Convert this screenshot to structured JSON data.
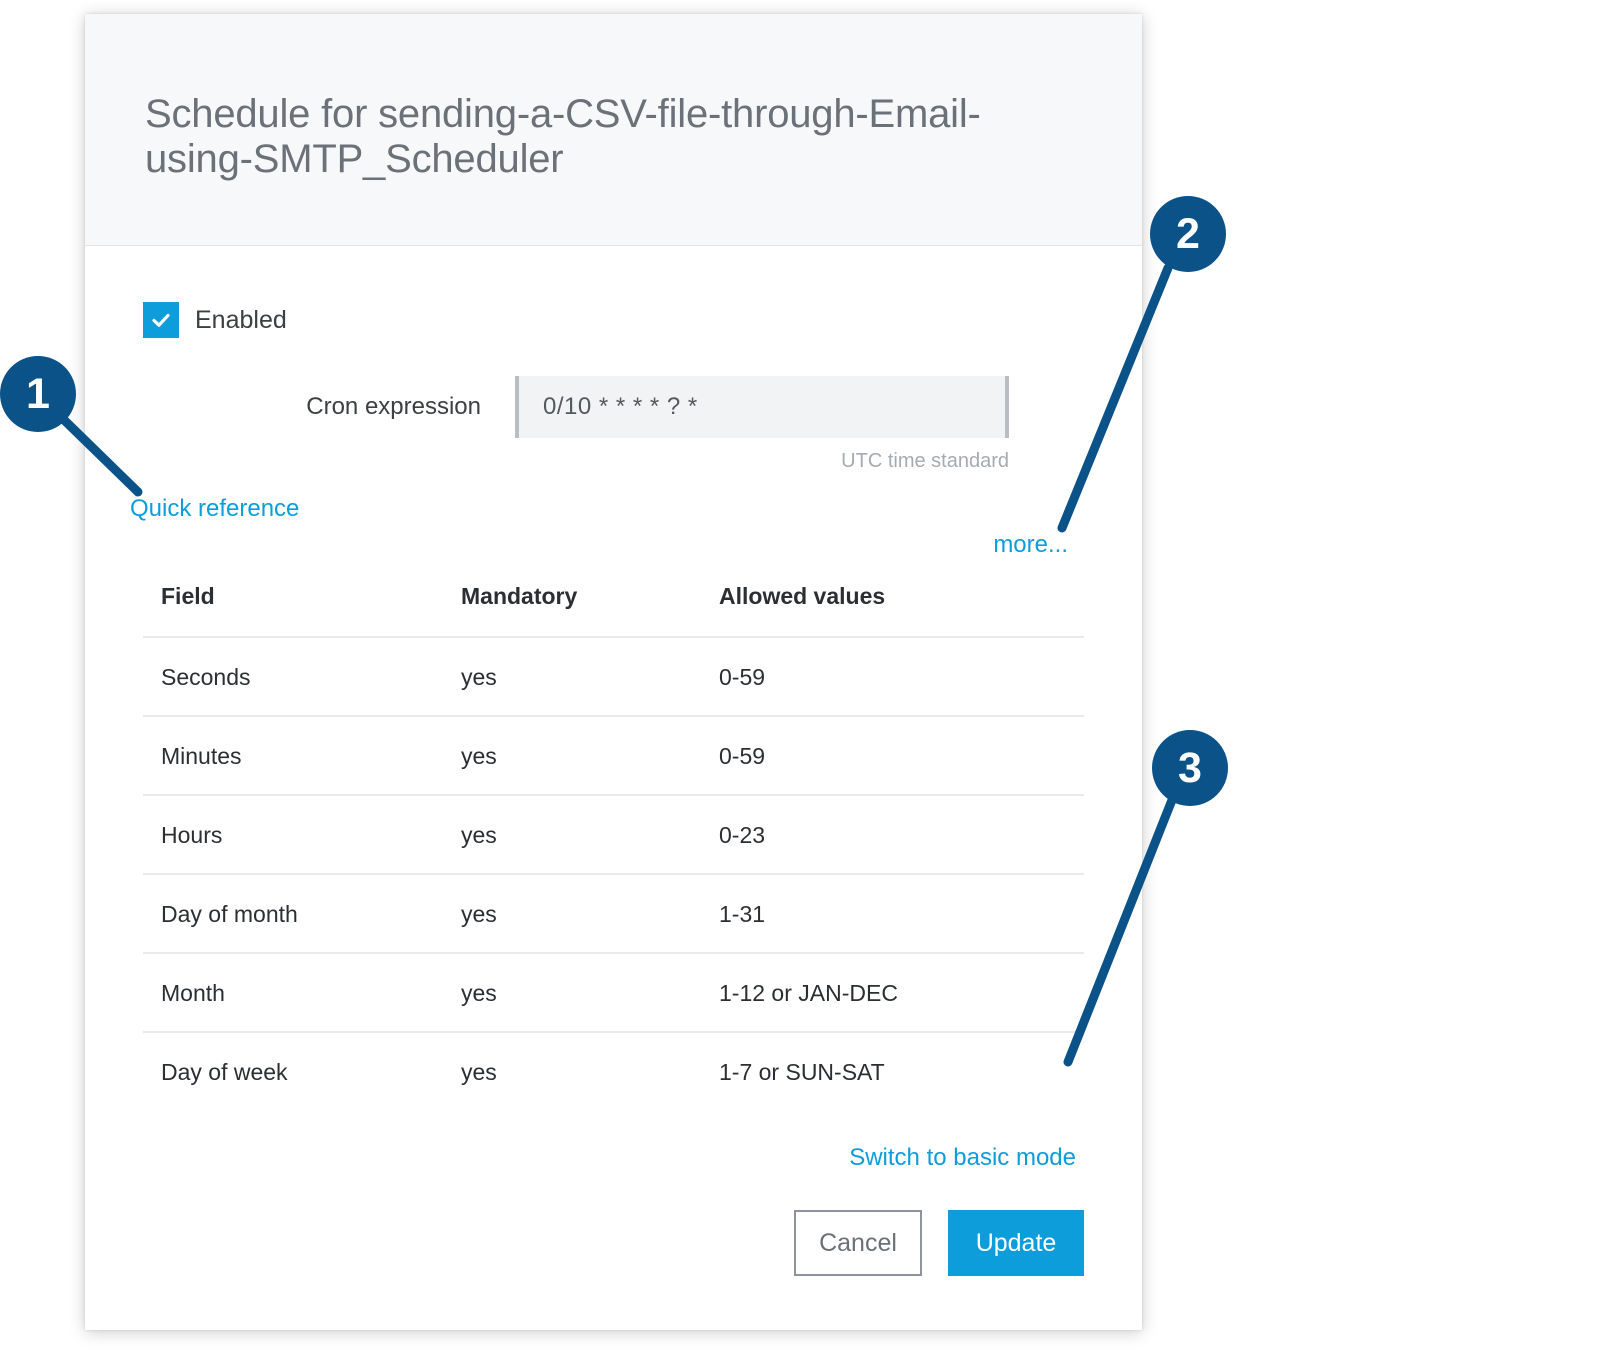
{
  "dialog": {
    "title": "Schedule for sending-a-CSV-file-through-Email-using-SMTP_Scheduler",
    "enabled": {
      "label": "Enabled",
      "checked": true,
      "accent_color": "#0d9ddb"
    },
    "cron": {
      "label": "Cron expression",
      "value": "0/10 * * * * ? *",
      "placeholder": "0/10 * * * * ? *",
      "hint": "UTC time standard"
    },
    "links": {
      "quick_reference": "Quick reference",
      "more": "more...",
      "switch_mode": "Switch to basic mode",
      "color": "#0d9ddb"
    },
    "quick_reference_table": {
      "columns": [
        "Field",
        "Mandatory",
        "Allowed values"
      ],
      "rows": [
        {
          "field": "Seconds",
          "mandatory": "yes",
          "allowed": "0-59"
        },
        {
          "field": "Minutes",
          "mandatory": "yes",
          "allowed": "0-59"
        },
        {
          "field": "Hours",
          "mandatory": "yes",
          "allowed": "0-23"
        },
        {
          "field": "Day of month",
          "mandatory": "yes",
          "allowed": "1-31"
        },
        {
          "field": "Month",
          "mandatory": "yes",
          "allowed": "1-12 or JAN-DEC"
        },
        {
          "field": "Day of week",
          "mandatory": "yes",
          "allowed": "1-7 or SUN-SAT"
        }
      ]
    },
    "buttons": {
      "cancel": "Cancel",
      "update": "Update",
      "update_color": "#0d9ddb"
    }
  },
  "callouts": {
    "color": "#0b5288",
    "items": [
      {
        "number": "1",
        "target": "quick-reference-link"
      },
      {
        "number": "2",
        "target": "more-link"
      },
      {
        "number": "3",
        "target": "switch-to-basic-mode-link"
      }
    ]
  }
}
